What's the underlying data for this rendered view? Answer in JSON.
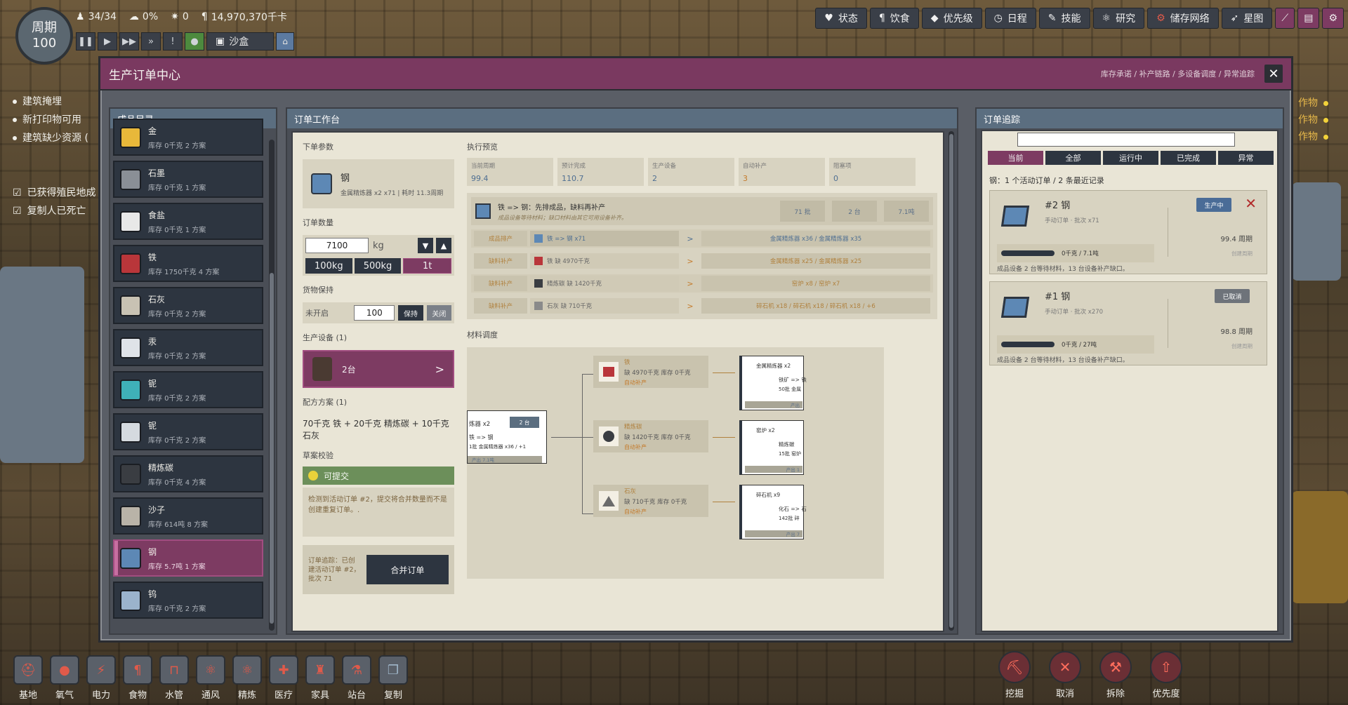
{
  "hud": {
    "cycle_label": "周期",
    "cycle_number": "100",
    "duplicants": "34/34",
    "stress": "0%",
    "sick": "0",
    "calories": "14,970,370千卡",
    "sandbox_label": "沙盒"
  },
  "top_menu": [
    {
      "label": "状态",
      "icon": "heart-icon"
    },
    {
      "label": "饮食",
      "icon": "fork-knife-icon"
    },
    {
      "label": "优先级",
      "icon": "priority-icon"
    },
    {
      "label": "日程",
      "icon": "clock-icon"
    },
    {
      "label": "技能",
      "icon": "wrench-icon"
    },
    {
      "label": "研究",
      "icon": "atom-icon"
    },
    {
      "label": "储存网络",
      "icon": "gear-icon"
    },
    {
      "label": "星图",
      "icon": "rocket-icon"
    }
  ],
  "notifications": [
    {
      "text": "建筑掩埋",
      "type": "info"
    },
    {
      "text": "新打印物可用",
      "type": "info"
    },
    {
      "text": "建筑缺少资源 (",
      "type": "info"
    },
    {
      "text": "已获得殖民地成",
      "type": "check"
    },
    {
      "text": "复制人已死亡",
      "type": "check"
    }
  ],
  "crops": [
    "作物",
    "作物",
    "作物"
  ],
  "bottom_tools": [
    "基地",
    "氧气",
    "电力",
    "食物",
    "水管",
    "通风",
    "精炼",
    "医疗",
    "家具",
    "站台",
    "复制"
  ],
  "bottom_actions": [
    "挖掘",
    "取消",
    "拆除",
    "优先度"
  ],
  "modal": {
    "title": "生产订单中心",
    "subtitle": "库存承诺 / 补产链路 / 多设备调度 / 异常追踪",
    "close": "✕"
  },
  "catalog": {
    "title": "成品目录",
    "items": [
      {
        "name": "金",
        "meta": "库存 0千克   2 方案",
        "color": "#e8b83a",
        "selected": false
      },
      {
        "name": "石墨",
        "meta": "库存 0千克   1 方案",
        "color": "#8a8f96",
        "selected": false
      },
      {
        "name": "食盐",
        "meta": "库存 0千克   1 方案",
        "color": "#e8e8e8",
        "selected": false
      },
      {
        "name": "铁",
        "meta": "库存 1750千克   4 方案",
        "color": "#b9363a",
        "selected": false
      },
      {
        "name": "石灰",
        "meta": "库存 0千克   2 方案",
        "color": "#c8c2b3",
        "selected": false
      },
      {
        "name": "汞",
        "meta": "库存 0千克   2 方案",
        "color": "#dfe3e8",
        "selected": false
      },
      {
        "name": "铌",
        "meta": "库存 0千克   2 方案",
        "color": "#3fb1b8",
        "selected": false
      },
      {
        "name": "铌",
        "meta": "库存 0千克   2 方案",
        "color": "#d5dadf",
        "selected": false
      },
      {
        "name": "精炼碳",
        "meta": "库存 0千克   4 方案",
        "color": "#3a3d42",
        "selected": false
      },
      {
        "name": "沙子",
        "meta": "库存 614吨   8 方案",
        "color": "#b9b3a8",
        "selected": false
      },
      {
        "name": "钢",
        "meta": "库存 5.7吨   1 方案",
        "color": "#5d88b5",
        "selected": true
      },
      {
        "name": "钨",
        "meta": "库存 0千克   2 方案",
        "color": "#9bb3cc",
        "selected": false
      }
    ]
  },
  "workbench": {
    "title": "订单工作台",
    "params_title": "下单参数",
    "product": {
      "name": "钢",
      "meta": "金属精炼器 x2 x71 | 耗时 11.3周期"
    },
    "qty_title": "订单数量",
    "qty_value": "7100",
    "qty_unit": "kg",
    "presets": [
      {
        "label": "100kg",
        "selected": false
      },
      {
        "label": "500kg",
        "selected": false
      },
      {
        "label": "1t",
        "selected": true
      }
    ],
    "hold_title": "货物保持",
    "hold_state": "未开启",
    "hold_value": "100",
    "hold_keep": "保持",
    "hold_close": "关闭",
    "equip_title": "生产设备 (1)",
    "equip_count": "2台",
    "equip_arrow": ">",
    "recipe_title": "配方方案 (1)",
    "recipe_text": "70千克 铁  +  20千克 精炼碳  +  10千克 石灰",
    "check_title": "草案校验",
    "check_status": "可提交",
    "check_note": "检测到活动订单 #2，提交将合并数量而不是创建重复订单。.",
    "merge_note": "订单追踪：已创建活动订单 #2，批次 71",
    "merge_button": "合并订单",
    "preview_title": "执行预览",
    "stats": [
      {
        "k": "当前周期",
        "v": "99.4",
        "warn": false
      },
      {
        "k": "预计完成",
        "v": "110.7",
        "warn": false
      },
      {
        "k": "生产设备",
        "v": "2",
        "warn": false
      },
      {
        "k": "自动补产",
        "v": "3",
        "warn": true
      },
      {
        "k": "阻塞项",
        "v": "0",
        "warn": false
      }
    ],
    "chain": {
      "title": "铁 => 钢：先排成品，缺料再补产",
      "sub": "成品设备等待材料；缺口材料由其它可用设备补齐。",
      "chips": [
        "71 批",
        "2 台",
        "7.1吨"
      ],
      "rows": [
        {
          "tag": "成品排产",
          "left": "铁 => 钢 x71",
          "right": "金属精炼器 x36 / 金属精炼器 x35",
          "first": true
        },
        {
          "tag": "缺料补产",
          "left": "铁  缺 4970千克",
          "right": "金属精炼器 x25 / 金属精炼器 x25",
          "first": false
        },
        {
          "tag": "缺料补产",
          "left": "精炼碳  缺 1420千克",
          "right": "窑炉 x8 / 窑炉 x7",
          "first": false
        },
        {
          "tag": "缺料补产",
          "left": "石灰  缺 710千克",
          "right": "碎石机 x18 / 碎石机 x18 / 碎石机 x18 / +6",
          "first": false
        }
      ]
    },
    "material_title": "材料调度",
    "materials": [
      {
        "name": "铁",
        "line": "缺 4970千克  库存 0千克",
        "auto": "自动补产"
      },
      {
        "name": "精炼碳",
        "line": "缺 1420千克  库存 0千克",
        "auto": "自动补产"
      },
      {
        "name": "石灰",
        "line": "缺 710千克  库存 0千克",
        "auto": "自动补产"
      }
    ],
    "source_node": {
      "title": "炼器 x2",
      "chip": "2 台",
      "line1": "铁 => 钢",
      "line2": "1批  金属精炼器 x36 / +1",
      "foot": "产出 7.1吨"
    },
    "supply_nodes": [
      {
        "title": "金属精炼器 x2",
        "line1": "铁矿 => 铁",
        "line2": "50批  金属",
        "foot": "产出"
      },
      {
        "title": "窑炉 x2",
        "line1": "精炼碳",
        "line2": "15批  窑炉",
        "foot": "产出 1"
      },
      {
        "title": "碎石机 x9",
        "line1": "化石 => 石",
        "line2": "142批  碎",
        "foot": "产出 7"
      }
    ]
  },
  "tracking": {
    "title": "订单追踪",
    "tabs": [
      {
        "label": "当前",
        "selected": true
      },
      {
        "label": "全部",
        "selected": false
      },
      {
        "label": "运行中",
        "selected": false
      },
      {
        "label": "已完成",
        "selected": false
      },
      {
        "label": "异常",
        "selected": false
      }
    ],
    "summary": "钢：1 个活动订单 / 2 条最近记录",
    "orders": [
      {
        "title": "#2 钢",
        "sub": "手动订单 · 批次 x71",
        "badge": "生产中",
        "progress_text": "0千克 / 7.1吨",
        "progress": 0.0,
        "week": "99.4 周期",
        "eta": "创建周期",
        "note": "成品设备 2 台等待材料，13 台设备补产缺口。"
      },
      {
        "title": "#1 钢",
        "sub": "手动订单 · 批次 x270",
        "badge": "已取消",
        "progress_text": "0千克 / 27吨",
        "progress": 0.0,
        "week": "98.8 周期",
        "eta": "创建周期",
        "note": "成品设备 2 台等待材料，13 台设备补产缺口。"
      }
    ]
  }
}
